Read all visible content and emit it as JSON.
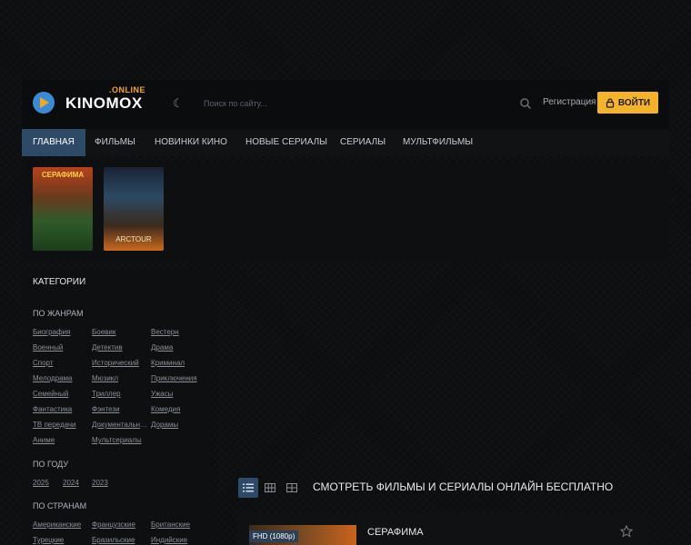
{
  "logo": {
    "name": "KINOMOX",
    "suffix": ".ONLINE"
  },
  "search": {
    "placeholder": "Поиск по сайту..."
  },
  "header": {
    "register_label": "Регистрация",
    "login_label": "ВОЙТИ"
  },
  "nav": {
    "items": [
      "ГЛАВНАЯ",
      "ФИЛЬМЫ",
      "НОВИНКИ КИНО",
      "НОВЫЕ СЕРИАЛЫ",
      "СЕРИАЛЫ",
      "МУЛЬТФИЛЬМЫ"
    ]
  },
  "posters": [
    {
      "label": "СЕРАФИМА"
    },
    {
      "label": "ARCTOUR"
    }
  ],
  "sidebar": {
    "title": "КАТЕГОРИИ",
    "genres_title": "ПО ЖАНРАМ",
    "genres": [
      "Биография",
      "Боевик",
      "Вестерн",
      "Военный",
      "Детектив",
      "Драма",
      "Спорт",
      "Исторический",
      "Криминал",
      "Мелодрама",
      "Мюзикл",
      "Приключения",
      "Семейный",
      "Триллер",
      "Ужасы",
      "Фантастика",
      "Фэнтези",
      "Комедия",
      "ТВ передачи",
      "Документальный",
      "Дорамы",
      "Аниме",
      "Мультсериалы"
    ],
    "years_title": "ПО ГОДУ",
    "years": [
      "2025",
      "2024",
      "2023"
    ],
    "countries_title": "ПО СТРАНАМ",
    "countries": [
      "Американские",
      "Французские",
      "Британские",
      "Турецкие",
      "Бразильские",
      "Индийские"
    ]
  },
  "main": {
    "title": "СМОТРЕТЬ ФИЛЬМЫ И СЕРИАЛЫ ОНЛАЙН БЕСПЛАТНО",
    "movie": {
      "title": "СЕРАФИМА",
      "quality": "FHD (1080p)"
    }
  },
  "colors": {
    "accent": "#f5b32a",
    "active": "#2e4a66",
    "background": "#0d0e10"
  }
}
